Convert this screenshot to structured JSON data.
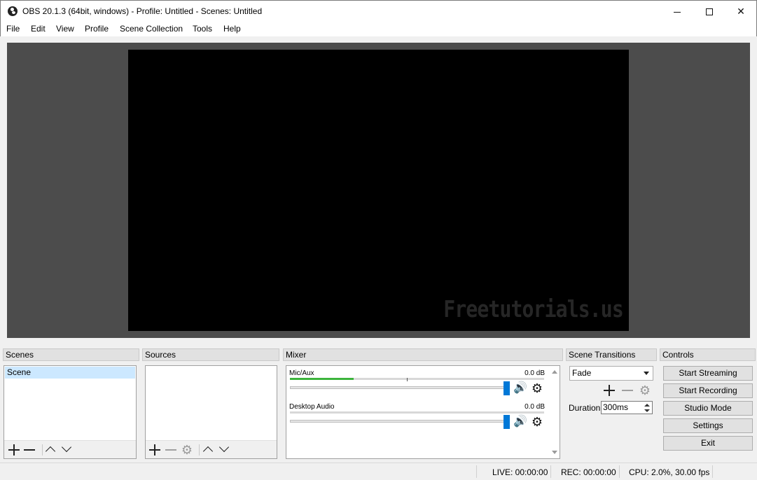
{
  "window": {
    "title": "OBS 20.1.3 (64bit, windows) - Profile: Untitled - Scenes: Untitled",
    "minimize": "",
    "maximize": "",
    "close": "✕"
  },
  "menu": [
    "File",
    "Edit",
    "View",
    "Profile",
    "Scene Collection",
    "Tools",
    "Help"
  ],
  "preview": {
    "watermark": "Freetutorials.us"
  },
  "scenes": {
    "title": "Scenes",
    "items": [
      "Scene"
    ]
  },
  "sources": {
    "title": "Sources",
    "items": []
  },
  "mixer": {
    "title": "Mixer",
    "channels": [
      {
        "name": "Mic/Aux",
        "db": "0.0 dB",
        "level": 0.25,
        "volume": 1.0
      },
      {
        "name": "Desktop Audio",
        "db": "0.0 dB",
        "level": 0.0,
        "volume": 1.0
      }
    ]
  },
  "transitions": {
    "title": "Scene Transitions",
    "selected": "Fade",
    "duration_label": "Duration",
    "duration_value": "300ms"
  },
  "controls": {
    "title": "Controls",
    "buttons": [
      "Start Streaming",
      "Start Recording",
      "Studio Mode",
      "Settings",
      "Exit"
    ]
  },
  "status": {
    "live": "LIVE: 00:00:00",
    "rec": "REC: 00:00:00",
    "cpu": "CPU: 2.0%, 30.00 fps"
  },
  "icons": {
    "gear": "⚙",
    "speaker": "🔊"
  }
}
